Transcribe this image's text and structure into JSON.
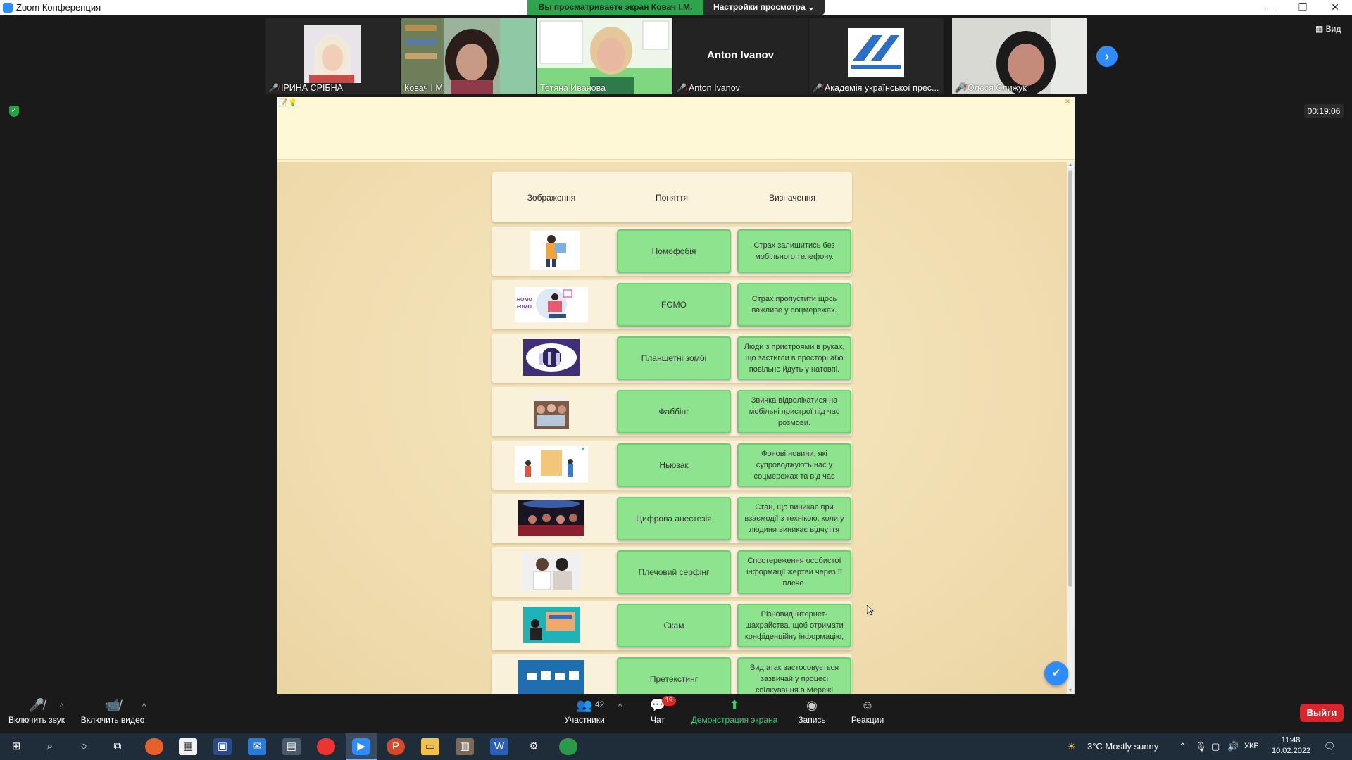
{
  "window": {
    "title": "Zoom Конференция"
  },
  "banner": {
    "viewing": "Вы просматриваете экран Ковач І.М.",
    "view_options": "Настройки просмотра ⌄"
  },
  "gallery": {
    "participants": [
      {
        "name": "ІРИНА СРІБНА",
        "muted": true
      },
      {
        "name": "Ковач І.М.",
        "muted": false
      },
      {
        "name": "Тетяна Иванова",
        "muted": false
      },
      {
        "name": "Anton Ivanov",
        "muted": true,
        "video_off": true
      },
      {
        "name": "Академія української прес...",
        "muted": true
      },
      {
        "name": "Олеся Слижук",
        "muted": true
      }
    ],
    "view_label": "Вид"
  },
  "timer": "00:19:06",
  "table": {
    "headers": [
      "Зображення",
      "Поняття",
      "Визначення"
    ],
    "rows": [
      {
        "concept": "Номофобія",
        "definition": "Страх залишитись без мобільного телефону."
      },
      {
        "concept": "FOMO",
        "definition": "Страх пропустити щось важливе у соцмережах."
      },
      {
        "concept": "Планшетні зомбі",
        "definition": "Люди з пристроями в руках, що застигли в просторі або повільно йдуть у натовпі."
      },
      {
        "concept": "Фаббінг",
        "definition": "Звичка відволікатися на мобільні пристрої під час розмови."
      },
      {
        "concept": "Ньюзак",
        "definition": "Фонові новини, які супроводжують нас у соцмережах та від час"
      },
      {
        "concept": "Цифрова анестезія",
        "definition": "Стан, що виникає при взаємодії з технікою, коли у людини виникає відчуття"
      },
      {
        "concept": "Плечовий серфінг",
        "definition": "Спостереження особистої інформації жертви через її плече."
      },
      {
        "concept": "Скам",
        "definition": "Різновид інтернет-шахрайства, щоб отримати конфіденційну інформацію,"
      },
      {
        "concept": "Претекстинг",
        "definition": "Вид атак застосовується зазвичай у процесі спілкування в Мережі"
      }
    ]
  },
  "controls": {
    "audio": "Включить звук",
    "video": "Включить видео",
    "participants": "Участники",
    "participants_count": "42",
    "chat": "Чат",
    "chat_badge": "19",
    "share": "Демонстрация экрана",
    "record": "Запись",
    "reactions": "Реакции",
    "leave": "Выйти"
  },
  "taskbar": {
    "weather": "3°C  Mostly sunny",
    "lang": "УКР",
    "time": "11:48",
    "date": "10.02.2022"
  }
}
